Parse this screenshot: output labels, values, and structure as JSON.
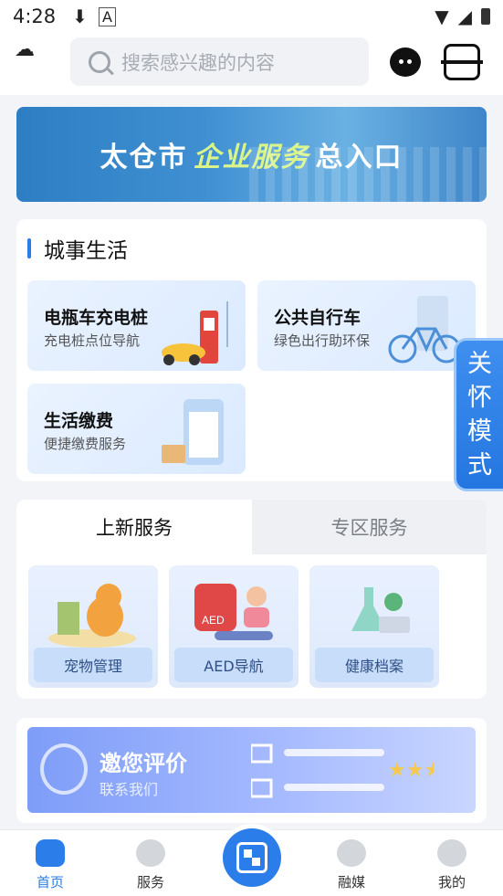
{
  "status_bar": {
    "time": "4:28"
  },
  "search": {
    "placeholder": "搜索感兴趣的内容"
  },
  "banner": {
    "prefix": "太仓市",
    "highlight": "企业服务",
    "suffix": "总入口"
  },
  "city_life": {
    "title": "城事生活",
    "tiles": [
      {
        "title": "电瓶车充电桩",
        "subtitle": "充电桩点位导航",
        "icon": "charging-station-icon"
      },
      {
        "title": "公共自行车",
        "subtitle": "绿色出行助环保",
        "icon": "bicycle-icon"
      },
      {
        "title": "生活缴费",
        "subtitle": "便捷缴费服务",
        "icon": "bill-icon"
      }
    ]
  },
  "care_mode": {
    "label": [
      "关",
      "怀",
      "模",
      "式"
    ]
  },
  "tabs": [
    {
      "label": "上新服务",
      "active": true
    },
    {
      "label": "专区服务",
      "active": false
    }
  ],
  "services": [
    {
      "label": "宠物管理",
      "icon": "pet-icon"
    },
    {
      "label": "AED导航",
      "icon": "aed-icon"
    },
    {
      "label": "健康档案",
      "icon": "health-record-icon"
    }
  ],
  "evaluation": {
    "title": "邀您评价",
    "subtitle": "联系我们"
  },
  "bottom_nav": [
    {
      "label": "首页",
      "active": true
    },
    {
      "label": "服务",
      "active": false
    },
    {
      "label": "融媒",
      "active": false
    },
    {
      "label": "我的",
      "active": false
    }
  ],
  "colors": {
    "accent": "#2b7de9",
    "background": "#f2f4f7"
  }
}
